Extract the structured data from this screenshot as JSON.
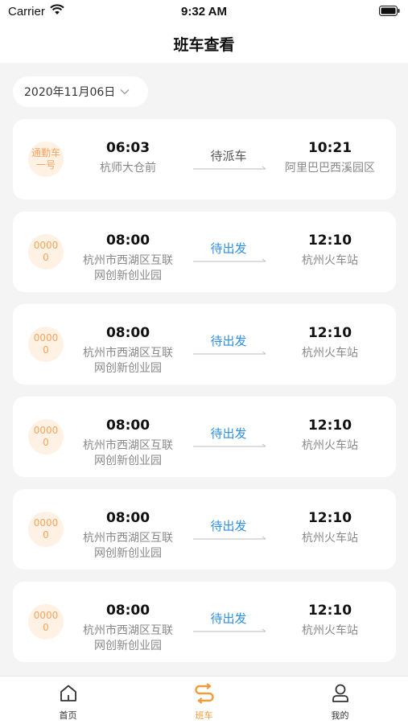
{
  "status_bar": {
    "carrier": "Carrier",
    "time": "9:32 AM"
  },
  "header": {
    "title": "班车查看"
  },
  "date_picker": {
    "value": "2020年11月06日"
  },
  "trips": [
    {
      "vehicle": "通勤车一号",
      "departure_time": "06:03",
      "departure_place": "杭师大仓前",
      "status": "待派车",
      "status_type": "pending",
      "arrival_time": "10:21",
      "arrival_place": "阿里巴巴西溪园区"
    },
    {
      "vehicle": "00000",
      "departure_time": "08:00",
      "departure_place": "杭州市西湖区互联网创新创业园",
      "status": "待出发",
      "status_type": "ready",
      "arrival_time": "12:10",
      "arrival_place": "杭州火车站"
    },
    {
      "vehicle": "00000",
      "departure_time": "08:00",
      "departure_place": "杭州市西湖区互联网创新创业园",
      "status": "待出发",
      "status_type": "ready",
      "arrival_time": "12:10",
      "arrival_place": "杭州火车站"
    },
    {
      "vehicle": "00000",
      "departure_time": "08:00",
      "departure_place": "杭州市西湖区互联网创新创业园",
      "status": "待出发",
      "status_type": "ready",
      "arrival_time": "12:10",
      "arrival_place": "杭州火车站"
    },
    {
      "vehicle": "00000",
      "departure_time": "08:00",
      "departure_place": "杭州市西湖区互联网创新创业园",
      "status": "待出发",
      "status_type": "ready",
      "arrival_time": "12:10",
      "arrival_place": "杭州火车站"
    },
    {
      "vehicle": "00000",
      "departure_time": "08:00",
      "departure_place": "杭州市西湖区互联网创新创业园",
      "status": "待出发",
      "status_type": "ready",
      "arrival_time": "12:10",
      "arrival_place": "杭州火车站"
    }
  ],
  "tabs": [
    {
      "label": "首页",
      "icon": "home-icon",
      "active": false
    },
    {
      "label": "班车",
      "icon": "route-icon",
      "active": true
    },
    {
      "label": "我的",
      "icon": "profile-icon",
      "active": false
    }
  ],
  "colors": {
    "accent": "#f29b3c",
    "status_ready": "#2f8fe0",
    "badge_bg": "#fff1e3",
    "badge_text": "#f7a55e"
  }
}
